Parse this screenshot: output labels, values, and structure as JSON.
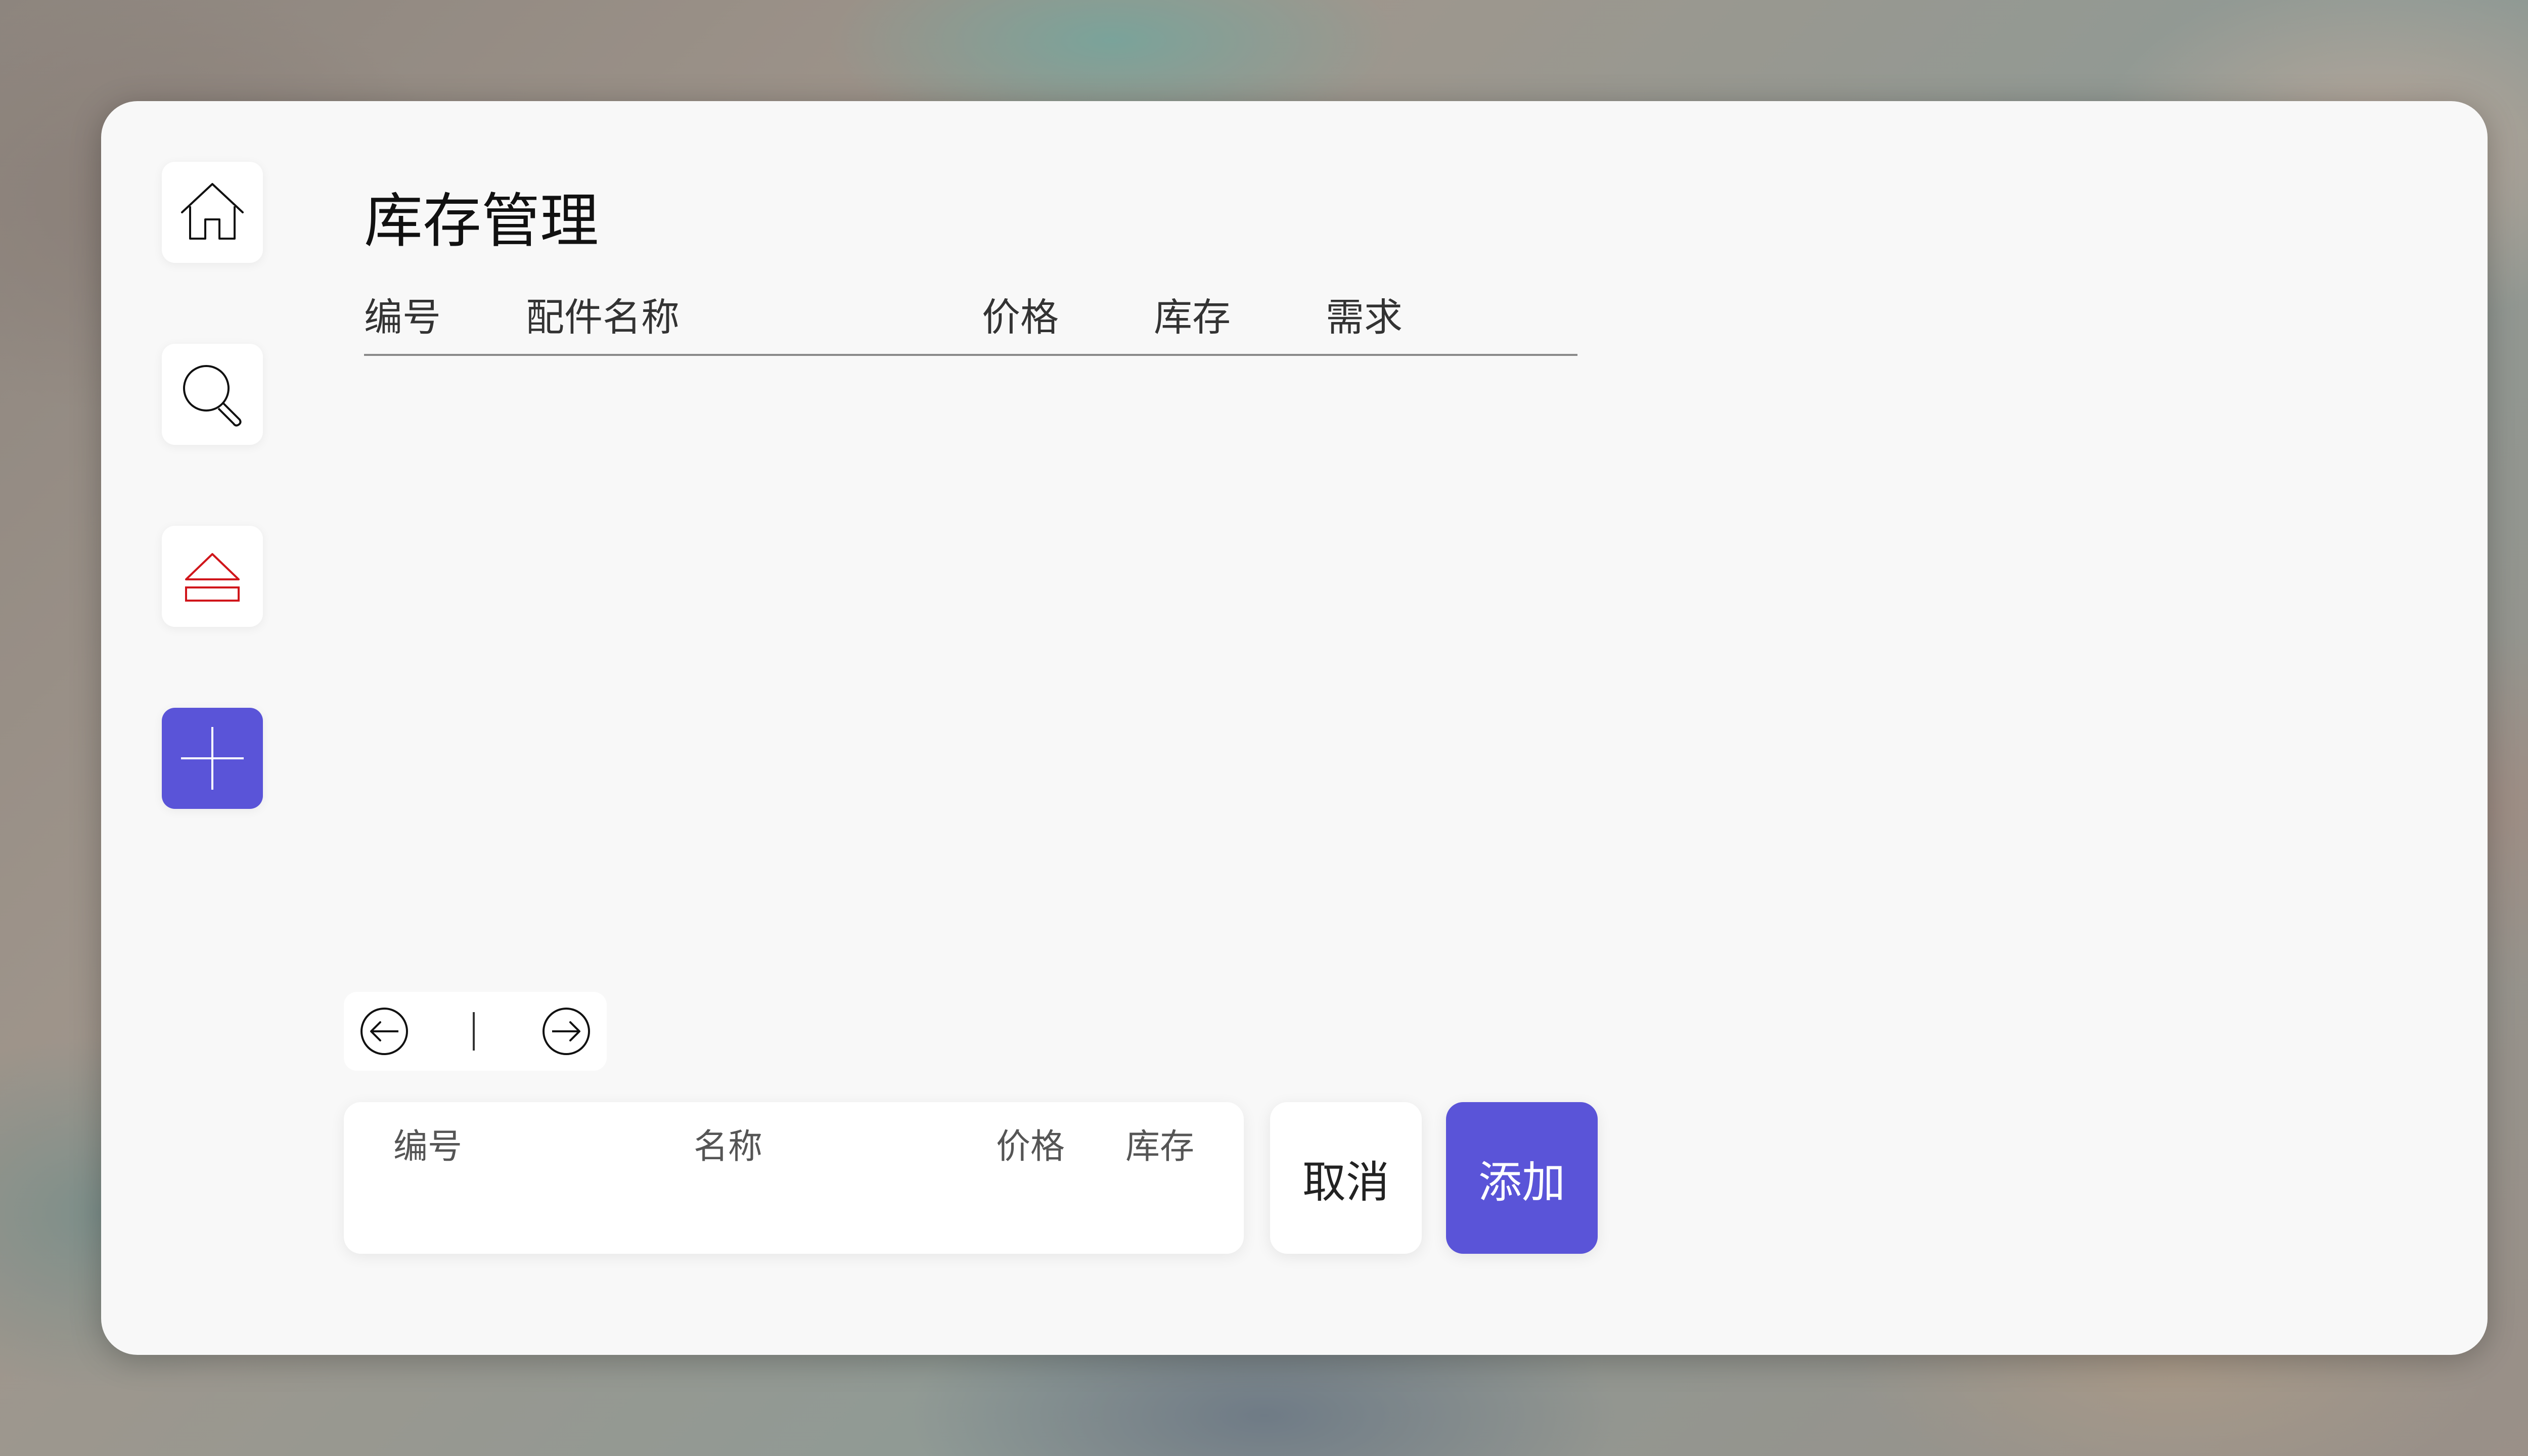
{
  "page": {
    "title": "库存管理"
  },
  "sidebar": {
    "items": [
      {
        "icon": "home-icon"
      },
      {
        "icon": "search-icon"
      },
      {
        "icon": "eject-icon"
      },
      {
        "icon": "plus-icon"
      }
    ]
  },
  "table": {
    "columns": [
      "编号",
      "配件名称",
      "价格",
      "库存",
      "需求"
    ],
    "rows": []
  },
  "pager": {
    "prev_icon": "arrow-left-circle-icon",
    "next_icon": "arrow-right-circle-icon"
  },
  "form": {
    "fields": {
      "id_label": "编号",
      "name_label": "名称",
      "price_label": "价格",
      "stock_label": "库存"
    },
    "cancel_label": "取消",
    "add_label": "添加"
  },
  "colors": {
    "accent": "#5a54d8",
    "danger": "#d0161b",
    "panel": "#f8f8f8"
  }
}
